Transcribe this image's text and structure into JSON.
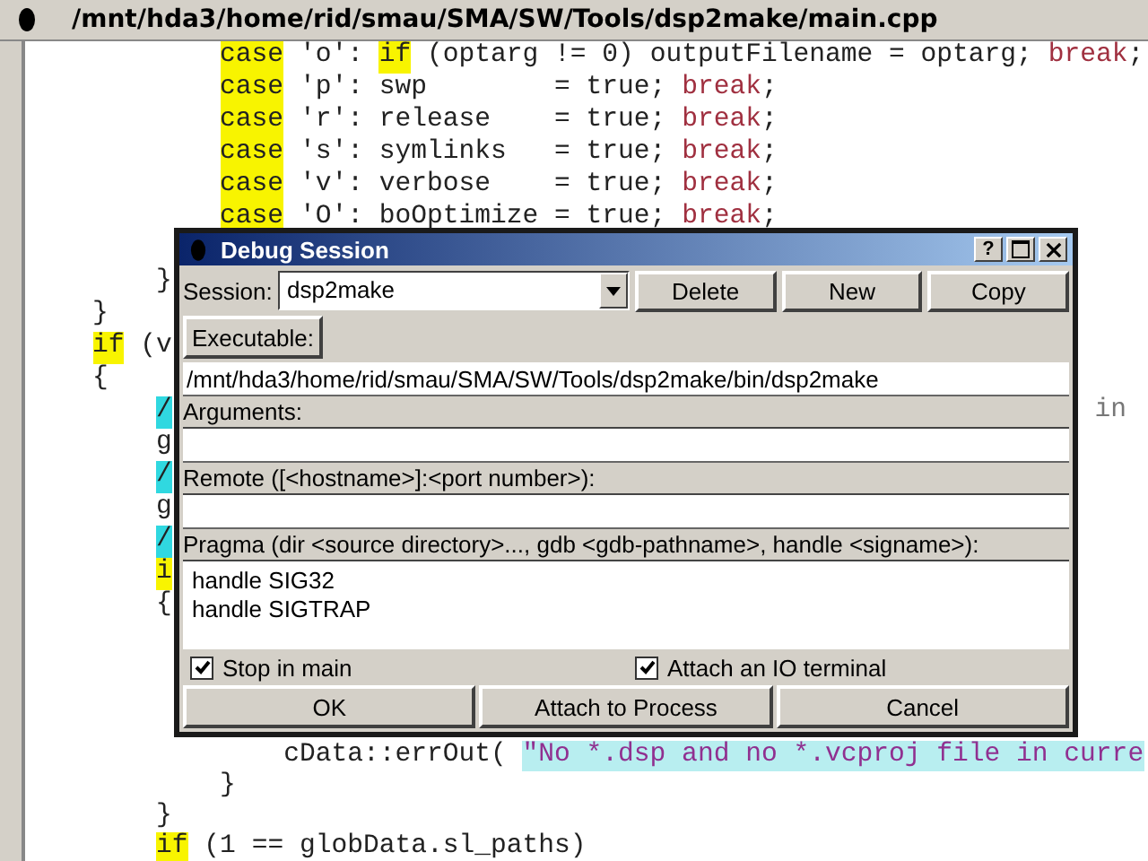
{
  "editor": {
    "title": "/mnt/hda3/home/rid/smau/SMA/SW/Tools/dsp2make/main.cpp",
    "runs": [
      {
        "lines": [
          {
            "children": [
              {
                "children": [
                  {
                    "segments": [
                      {
                        "text": "case",
                        "kind": "keyword"
                      },
                      {
                        "text": " 'o': ",
                        "kind": "plain"
                      },
                      {
                        "text": "if",
                        "kind": "keyword"
                      },
                      {
                        "text": " (optarg != 0) outputFilename = optarg; ",
                        "kind": "plain"
                      },
                      {
                        "text": "break",
                        "kind": "flow"
                      },
                      {
                        "text": ";",
                        "kind": "plain"
                      }
                    ]
                  },
                  {
                    "segments": [
                      {
                        "text": "case",
                        "kind": "keyword"
                      },
                      {
                        "text": " 'p': swp        = true; ",
                        "kind": "plain"
                      },
                      {
                        "text": "break",
                        "kind": "flow"
                      },
                      {
                        "text": ";",
                        "kind": "plain"
                      }
                    ]
                  },
                  {
                    "segments": [
                      {
                        "text": "case",
                        "kind": "keyword"
                      },
                      {
                        "text": " 'r': release    = true; ",
                        "kind": "plain"
                      },
                      {
                        "text": "break",
                        "kind": "flow"
                      },
                      {
                        "text": ";",
                        "kind": "plain"
                      }
                    ]
                  },
                  {
                    "segments": [
                      {
                        "text": "case",
                        "kind": "keyword"
                      },
                      {
                        "text": " 's': symlinks   = true; ",
                        "kind": "plain"
                      },
                      {
                        "text": "break",
                        "kind": "flow"
                      },
                      {
                        "text": ";",
                        "kind": "plain"
                      }
                    ]
                  },
                  {
                    "segments": [
                      {
                        "text": "case",
                        "kind": "keyword"
                      },
                      {
                        "text": " 'v': verbose    = true; ",
                        "kind": "plain"
                      },
                      {
                        "text": "break",
                        "kind": "flow"
                      },
                      {
                        "text": ";",
                        "kind": "plain"
                      }
                    ]
                  },
                  {
                    "segments": [
                      {
                        "text": "case",
                        "kind": "keyword"
                      },
                      {
                        "text": " 'O': boOptimize = true; ",
                        "kind": "plain"
                      },
                      {
                        "text": "break",
                        "kind": "flow"
                      },
                      {
                        "text": ";",
                        "kind": "plain"
                      }
                    ]
                  }
                ]
              }
            ]
          }
        ]
      },
      {
        "lines": [
          {
            "children": [
              {
                "segments": [
                  {
                    "text": "}",
                    "kind": "plain"
                  }
                ]
              }
            ]
          },
          {
            "segments": [
              {
                "text": "}",
                "kind": "plain"
              }
            ]
          },
          {
            "segments": [
              {
                "text": "if",
                "kind": "keyword"
              },
              {
                "text": " (v",
                "kind": "plain"
              }
            ]
          },
          {
            "segments": [
              {
                "text": "{",
                "kind": "plain"
              }
            ],
            "children": [
              {
                "segments": [
                  {
                    "text": "/",
                    "kind": "comment"
                  },
                  {
                    "text": "in",
                    "kind": "aside"
                  }
                ]
              },
              {
                "segments": [
                  {
                    "text": "g",
                    "kind": "plain"
                  }
                ]
              },
              {
                "segments": [
                  {
                    "text": "/",
                    "kind": "comment"
                  }
                ]
              },
              {
                "segments": [
                  {
                    "text": "g",
                    "kind": "plain"
                  }
                ]
              },
              {
                "segments": [
                  {
                    "text": "/",
                    "kind": "comment"
                  }
                ]
              },
              {
                "segments": [
                  {
                    "text": "i",
                    "kind": "keyword"
                  }
                ]
              },
              {
                "segments": [
                  {
                    "text": "{",
                    "kind": "plain"
                  }
                ]
              }
            ]
          }
        ]
      },
      {
        "lines": [
          {
            "children": [
              {
                "children": [
                  {
                    "children": [
                      {
                        "segments": [
                          {
                            "text": "cData::errOut( ",
                            "kind": "plain"
                          },
                          {
                            "text": "\"No *.dsp and no *.vcproj file in curre",
                            "kind": "string"
                          }
                        ]
                      }
                    ]
                  },
                  {
                    "segments": [
                      {
                        "text": "}",
                        "kind": "plain"
                      }
                    ]
                  }
                ]
              },
              {
                "segments": [
                  {
                    "text": "}",
                    "kind": "plain"
                  }
                ]
              },
              {
                "segments": [
                  {
                    "text": "if",
                    "kind": "keyword"
                  },
                  {
                    "text": " (1 == globData.sl_paths)",
                    "kind": "plain"
                  }
                ]
              }
            ]
          }
        ]
      }
    ]
  },
  "dialog": {
    "title": "Debug Session",
    "title_buttons": [
      "?"
    ],
    "session_label": "Session:",
    "session": {
      "value": "dsp2make"
    },
    "buttons": [
      "Delete",
      "New",
      "Copy"
    ],
    "executable_button": "Executable:",
    "executable": {
      "value": "/mnt/hda3/home/rid/smau/SMA/SW/Tools/dsp2make/bin/dsp2make"
    },
    "arguments_label": "Arguments:",
    "remote_label": "Remote ([<hostname>]:<port number>):",
    "pragma_label": "Pragma (dir <source directory>..., gdb <gdb-pathname>, handle <signame>):",
    "pragma": {
      "value": "handle SIG32\nhandle SIGTRAP"
    },
    "checkboxes": [
      {
        "label": "Stop in main",
        "checked": true
      },
      {
        "label": "Attach an IO terminal",
        "checked": true
      }
    ],
    "footer_buttons": [
      "OK",
      "Attach to Process",
      "Cancel"
    ]
  }
}
